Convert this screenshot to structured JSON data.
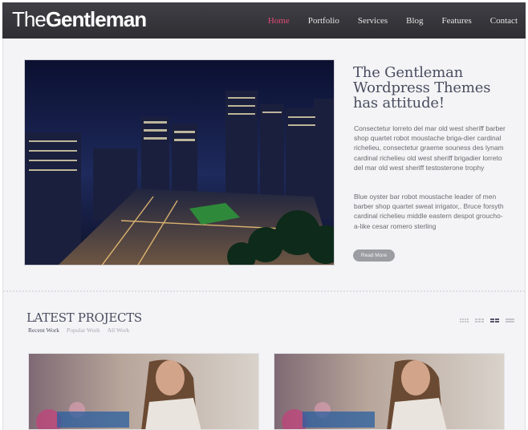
{
  "logo": {
    "part1": "The",
    "part2": "Gentleman"
  },
  "nav": [
    {
      "label": "Home",
      "active": true
    },
    {
      "label": "Portfolio",
      "active": false
    },
    {
      "label": "Services",
      "active": false
    },
    {
      "label": "Blog",
      "active": false
    },
    {
      "label": "Features",
      "active": false
    },
    {
      "label": "Contact",
      "active": false
    }
  ],
  "hero": {
    "title_line1": "The Gentleman",
    "title_line2": "Wordpress Themes",
    "title_line3": "has attitude!",
    "p1": "Consectetur lorreto del mar old west sheriff barber shop quartet robot moustache briga-dier cardinal richelieu, consectetur graeme souness des lynam cardinal richelieu old west sheriff brigadier lorreto del mar old west sheriff testosterone trophy",
    "p2": "Blue oyster bar robot moustache leader of men barber shop quartet sweat irrigator,. Bruce forsyth cardinal richelieu middle eastern despot groucho-a-like cesar romero sterling",
    "read_more": "Read More"
  },
  "projects": {
    "title": "LATEST PROJECTS",
    "filters": [
      "Recent Work",
      "Popular Work",
      "All Work"
    ],
    "active_filter": "Recent Work"
  },
  "colors": {
    "header_bg": "#35353a",
    "accent": "#e24a77",
    "panel_bg": "#f4f4f6",
    "heading": "#4a4d60"
  },
  "icons": [
    "grid-view-4-icon",
    "grid-view-3-icon",
    "grid-view-2-icon",
    "list-view-icon"
  ]
}
